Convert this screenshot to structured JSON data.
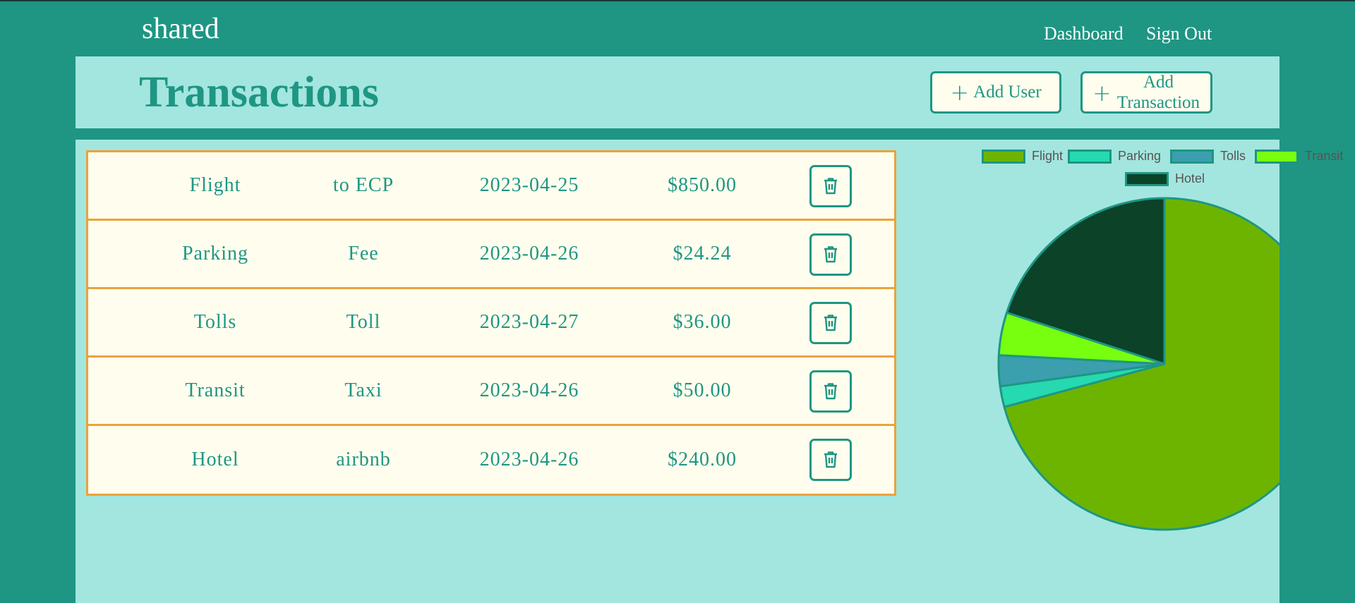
{
  "nav": {
    "brand": "shared",
    "dashboard": "Dashboard",
    "signout": "Sign Out"
  },
  "header": {
    "title": "Transactions",
    "add_user": "Add User",
    "add_transaction": "Add Transaction"
  },
  "transactions": [
    {
      "category": "Flight",
      "description": "to ECP",
      "date": "2023-04-25",
      "amount": "$850.00"
    },
    {
      "category": "Parking",
      "description": "Fee",
      "date": "2023-04-26",
      "amount": "$24.24"
    },
    {
      "category": "Tolls",
      "description": "Toll",
      "date": "2023-04-27",
      "amount": "$36.00"
    },
    {
      "category": "Transit",
      "description": "Taxi",
      "date": "2023-04-26",
      "amount": "$50.00"
    },
    {
      "category": "Hotel",
      "description": "airbnb",
      "date": "2023-04-26",
      "amount": "$240.00"
    }
  ],
  "icons": {
    "add": "plus-icon",
    "delete": "trash-icon"
  },
  "colors": {
    "background": "#1e9683",
    "panel": "#a3e6df",
    "row": "#fffdee",
    "border": "#eba33a"
  },
  "chart_data": {
    "type": "pie",
    "categories": [
      "Flight",
      "Parking",
      "Tolls",
      "Transit",
      "Hotel"
    ],
    "values": [
      850.0,
      24.24,
      36.0,
      50.0,
      240.0
    ],
    "colors": [
      "#6db400",
      "#26d9b0",
      "#3b9fae",
      "#78ff10",
      "#0b4228"
    ],
    "legend": "top"
  }
}
